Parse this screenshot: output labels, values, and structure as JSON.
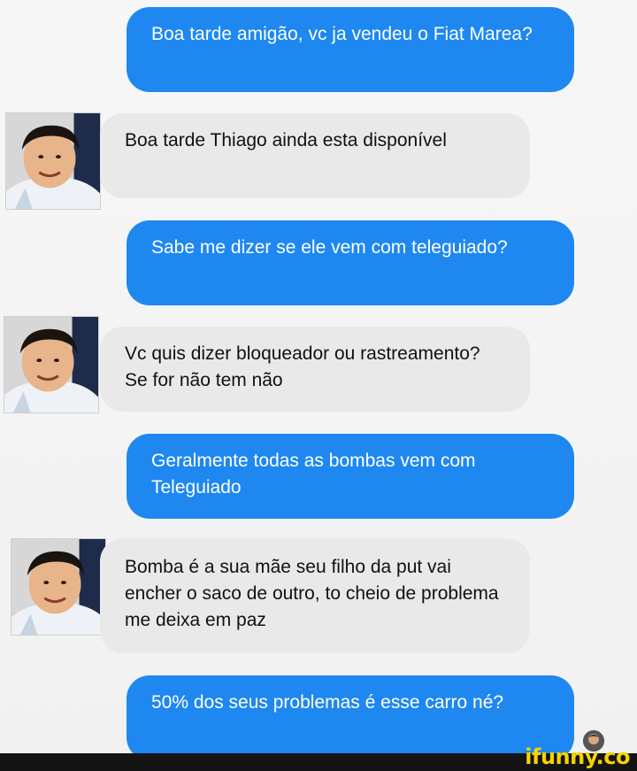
{
  "messages": [
    {
      "from": "me",
      "text": "Boa tarde amigão, vc ja vendeu o Fiat Marea?"
    },
    {
      "from": "seller",
      "text": "Boa tarde Thiago ainda esta disponível"
    },
    {
      "from": "me",
      "text": "Sabe me dizer se ele vem com teleguiado?"
    },
    {
      "from": "seller",
      "text": "Vc quis dizer bloqueador ou rastreamento? Se for não tem não"
    },
    {
      "from": "me",
      "text": "Geralmente todas as bombas vem com Teleguiado"
    },
    {
      "from": "seller",
      "text": "Bomba é a sua mãe seu filho da put vai encher o saco de outro, to cheio de problema me deixa em paz"
    },
    {
      "from": "me",
      "text": "50% dos seus problemas é esse carro né?"
    }
  ],
  "watermark": "ifunny.co",
  "icons": {
    "avatar": "person-photo-icon",
    "seen": "seen-avatar-icon"
  },
  "colors": {
    "sent": "#1e88f0",
    "received": "#e9e9e9",
    "watermark": "#f6d300"
  }
}
